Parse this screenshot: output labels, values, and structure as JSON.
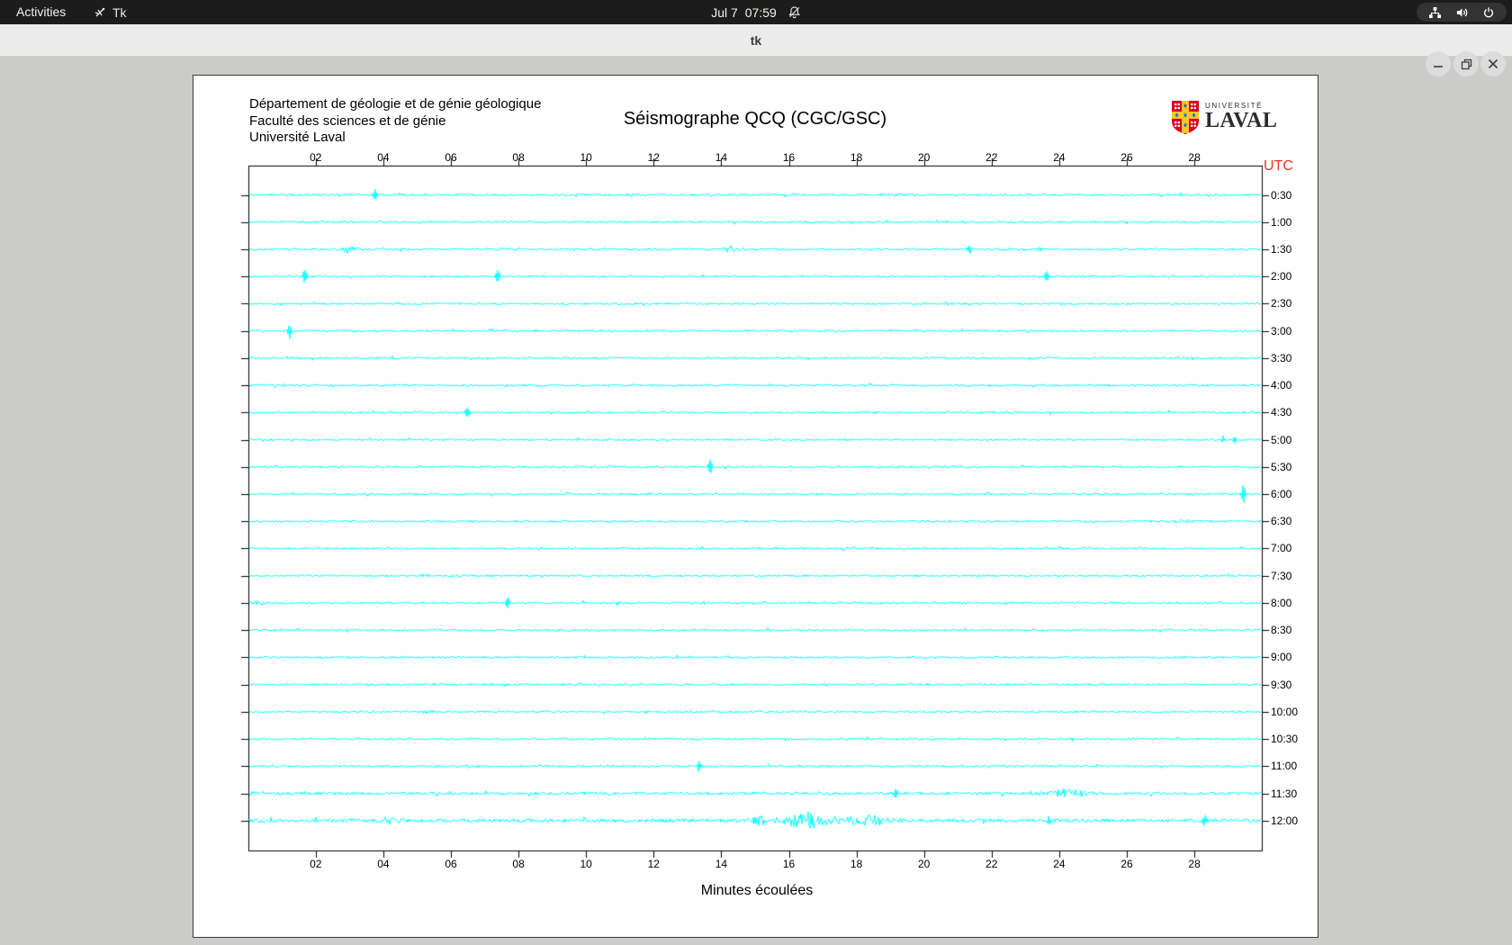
{
  "topbar": {
    "activities": "Activities",
    "app_name": "Tk",
    "clock_date": "Jul 7",
    "clock_time": "07:59"
  },
  "titlebar": {
    "title": "tk"
  },
  "window": {
    "header_lines": {
      "l1": "Département de géologie et de génie géologique",
      "l2": "Faculté des sciences et de génie",
      "l3": "Université Laval"
    },
    "title": "Séismographe QCQ (CGC/GSC)",
    "utc_label": "UTC",
    "xlabel": "Minutes écoulées",
    "logo": {
      "line1": "UNIVERSITÉ",
      "line2": "LAVAL"
    }
  },
  "colors": {
    "trace": "#00ffff",
    "axis": "#000000",
    "utc_red": "#f03022",
    "logo_red": "#d6001c",
    "logo_gold": "#ffc629",
    "logo_blue": "#1f74c0"
  },
  "chart_data": {
    "type": "line",
    "title": "Séismographe QCQ (CGC/GSC)",
    "xlabel": "Minutes écoulées",
    "x_range": [
      0,
      30
    ],
    "x_ticks": [
      "02",
      "04",
      "06",
      "08",
      "10",
      "12",
      "14",
      "16",
      "18",
      "20",
      "22",
      "24",
      "26",
      "28"
    ],
    "y_axis_side": "right",
    "y_axis_title": "UTC",
    "grid": false,
    "rows": [
      {
        "label": "0:30",
        "noise": 1.1,
        "events": [
          {
            "m": 3.75,
            "amp": 9,
            "w": 0.1
          },
          {
            "m": 27.6,
            "amp": 2.5,
            "w": 0.15,
            "dense": true
          }
        ]
      },
      {
        "label": "1:00",
        "noise": 1.1,
        "events": [
          {
            "m": 25.9,
            "amp": 2,
            "w": 0.12,
            "dense": true
          }
        ]
      },
      {
        "label": "1:30",
        "noise": 1.1,
        "events": [
          {
            "m": 2.95,
            "amp": 4,
            "w": 0.4,
            "dense": true
          },
          {
            "m": 14.3,
            "amp": 4,
            "w": 0.4,
            "dense": true
          },
          {
            "m": 21.35,
            "amp": 6,
            "w": 0.1
          },
          {
            "m": 23.4,
            "amp": 2.5,
            "w": 0.12,
            "dense": true
          }
        ]
      },
      {
        "label": "2:00",
        "noise": 1.1,
        "events": [
          {
            "m": 1.68,
            "amp": 9,
            "w": 0.1
          },
          {
            "m": 7.38,
            "amp": 9,
            "w": 0.1
          },
          {
            "m": 23.63,
            "amp": 7,
            "w": 0.1
          }
        ]
      },
      {
        "label": "2:30",
        "noise": 1.1,
        "events": []
      },
      {
        "label": "3:00",
        "noise": 1.1,
        "events": [
          {
            "m": 1.23,
            "amp": 8,
            "w": 0.1
          }
        ]
      },
      {
        "label": "3:30",
        "noise": 1.1,
        "events": []
      },
      {
        "label": "4:00",
        "noise": 1.1,
        "events": []
      },
      {
        "label": "4:30",
        "noise": 1.1,
        "events": [
          {
            "m": 6.49,
            "amp": 7,
            "w": 0.1
          }
        ]
      },
      {
        "label": "5:00",
        "noise": 1.1,
        "events": [
          {
            "m": 28.85,
            "amp": 5,
            "w": 0.08
          },
          {
            "m": 29.2,
            "amp": 6,
            "w": 0.08
          }
        ]
      },
      {
        "label": "5:30",
        "noise": 1.1,
        "events": [
          {
            "m": 13.67,
            "amp": 10,
            "w": 0.1
          }
        ]
      },
      {
        "label": "6:00",
        "noise": 1.1,
        "events": [
          {
            "m": 29.45,
            "amp": 11,
            "w": 0.1
          }
        ]
      },
      {
        "label": "6:30",
        "noise": 1.1,
        "events": []
      },
      {
        "label": "7:00",
        "noise": 1.1,
        "events": []
      },
      {
        "label": "7:30",
        "noise": 1.1,
        "events": [
          {
            "m": 5.15,
            "amp": 2.5,
            "w": 0.25,
            "dense": true
          }
        ]
      },
      {
        "label": "8:00",
        "noise": 1.1,
        "events": [
          {
            "m": 0.2,
            "amp": 4,
            "w": 0.25,
            "dense": true
          },
          {
            "m": 7.68,
            "amp": 8,
            "w": 0.1
          },
          {
            "m": 10.93,
            "amp": 3,
            "w": 0.1
          }
        ]
      },
      {
        "label": "8:30",
        "noise": 1.1,
        "events": []
      },
      {
        "label": "9:00",
        "noise": 1.1,
        "events": []
      },
      {
        "label": "9:30",
        "noise": 1.1,
        "events": [
          {
            "m": 5.44,
            "amp": 2,
            "w": 0.25,
            "dense": true
          }
        ]
      },
      {
        "label": "10:00",
        "noise": 1.1,
        "events": [
          {
            "m": 5.3,
            "amp": 1.8,
            "w": 0.3,
            "dense": true
          }
        ]
      },
      {
        "label": "10:30",
        "noise": 1.1,
        "events": []
      },
      {
        "label": "11:00",
        "noise": 1.1,
        "events": [
          {
            "m": 13.35,
            "amp": 7,
            "w": 0.1
          }
        ]
      },
      {
        "label": "11:30",
        "noise": 1.5,
        "events": [
          {
            "m": 0.18,
            "amp": 4,
            "w": 0.22,
            "dense": true
          },
          {
            "m": 19.15,
            "amp": 4,
            "w": 0.12
          },
          {
            "m": 24.15,
            "amp": 5,
            "w": 1.1,
            "dense": true
          }
        ]
      },
      {
        "label": "12:00",
        "noise": 1.9,
        "events": [
          {
            "m": 0.65,
            "amp": 4,
            "w": 0.2,
            "dense": true
          },
          {
            "m": 4.2,
            "amp": 3.5,
            "w": 0.55,
            "dense": true
          },
          {
            "m": 15.2,
            "amp": 6,
            "w": 0.5,
            "dense": true
          },
          {
            "m": 16.6,
            "amp": 10,
            "w": 1.1,
            "dense": true
          },
          {
            "m": 18.3,
            "amp": 6,
            "w": 1.2,
            "dense": true
          },
          {
            "m": 23.7,
            "amp": 5,
            "w": 0.1
          },
          {
            "m": 28.3,
            "amp": 8,
            "w": 0.1
          }
        ]
      }
    ]
  }
}
